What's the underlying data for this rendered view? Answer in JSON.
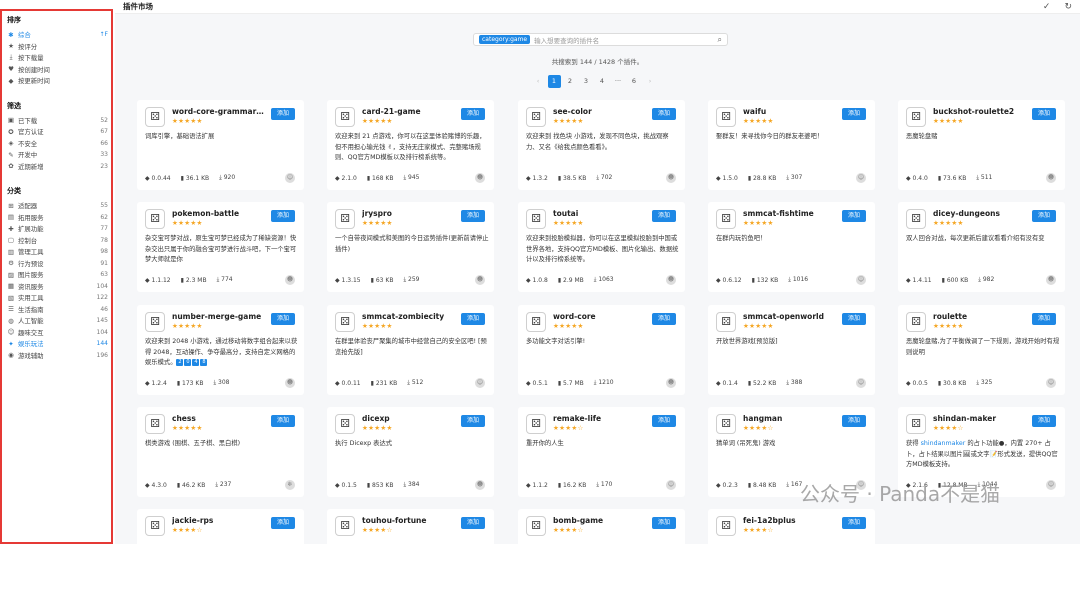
{
  "sidebar": {
    "sort_title": "排序",
    "sort_items": [
      {
        "label": "综合",
        "icon": "sparkle-icon",
        "glyph": "✱",
        "count": "↑F",
        "active": true
      },
      {
        "label": "按评分",
        "icon": "star-icon",
        "glyph": "★",
        "count": "",
        "active": false
      },
      {
        "label": "按下载量",
        "icon": "download-icon",
        "glyph": "⤓",
        "count": "",
        "active": false
      },
      {
        "label": "按创建时间",
        "icon": "heart-icon",
        "glyph": "♥",
        "count": "",
        "active": false
      },
      {
        "label": "按更新时间",
        "icon": "tag-icon",
        "glyph": "◆",
        "count": "",
        "active": false
      }
    ],
    "filter_title": "筛选",
    "filter_items": [
      {
        "label": "已下载",
        "icon": "lock-icon",
        "glyph": "▣",
        "count": "52"
      },
      {
        "label": "官方认证",
        "icon": "badge-icon",
        "glyph": "✪",
        "count": "67"
      },
      {
        "label": "不安全",
        "icon": "shield-icon",
        "glyph": "◈",
        "count": "66"
      },
      {
        "label": "开发中",
        "icon": "wrench-icon",
        "glyph": "✎",
        "count": "33"
      },
      {
        "label": "近期新增",
        "icon": "sprout-icon",
        "glyph": "✿",
        "count": "23"
      }
    ],
    "category_title": "分类",
    "category_items": [
      {
        "label": "适配器",
        "icon": "adapter-icon",
        "glyph": "⊞",
        "count": "55",
        "active": false
      },
      {
        "label": "拓用服务",
        "icon": "service-icon",
        "glyph": "▤",
        "count": "62",
        "active": false
      },
      {
        "label": "扩展功能",
        "icon": "puzzle-icon",
        "glyph": "✚",
        "count": "77",
        "active": false
      },
      {
        "label": "控制台",
        "icon": "console-icon",
        "glyph": "▢",
        "count": "78",
        "active": false
      },
      {
        "label": "管理工具",
        "icon": "tools-icon",
        "glyph": "▥",
        "count": "98",
        "active": false
      },
      {
        "label": "行为预设",
        "icon": "behavior-icon",
        "glyph": "⚙",
        "count": "91",
        "active": false
      },
      {
        "label": "图片服务",
        "icon": "image-icon",
        "glyph": "▨",
        "count": "63",
        "active": false
      },
      {
        "label": "资讯服务",
        "icon": "news-icon",
        "glyph": "▦",
        "count": "104",
        "active": false
      },
      {
        "label": "实用工具",
        "icon": "utility-icon",
        "glyph": "▧",
        "count": "122",
        "active": false
      },
      {
        "label": "生活指南",
        "icon": "life-icon",
        "glyph": "☰",
        "count": "46",
        "active": false
      },
      {
        "label": "人工智能",
        "icon": "ai-icon",
        "glyph": "◍",
        "count": "145",
        "active": false
      },
      {
        "label": "趣味交互",
        "icon": "fun-icon",
        "glyph": "☺",
        "count": "104",
        "active": false
      },
      {
        "label": "娱乐玩法",
        "icon": "entertainment-icon",
        "glyph": "✦",
        "count": "144",
        "active": true
      },
      {
        "label": "游戏辅助",
        "icon": "gamepad-icon",
        "glyph": "◉",
        "count": "196",
        "active": false
      }
    ]
  },
  "header": {
    "title": "插件市场",
    "check_glyph": "✓",
    "refresh_glyph": "↻"
  },
  "search": {
    "tag": "category:game",
    "placeholder": "输入想要查询的插件名",
    "icon_glyph": "⌕"
  },
  "results_text": "共搜索到 144 / 1428 个插件。",
  "pagination": {
    "prev": "‹",
    "pages": [
      "1",
      "2",
      "3",
      "4",
      "···",
      "6"
    ],
    "next": "›",
    "current": "1"
  },
  "add_label": "添加",
  "watermark": "公众号 · Panda不是猫",
  "cards": [
    {
      "name": "word-core-grammar-...",
      "stars": "★★★★★",
      "desc": "词库引擎，基础语法扩展",
      "version": "0.0.44",
      "size": "36.1 KB",
      "downloads": "920",
      "avatar": "☺"
    },
    {
      "name": "card-21-game",
      "stars": "★★★★★",
      "desc": "欢迎来到 21 点游戏，你可以在这里体验赌博的乐趣，但不用担心输光钱 ✌，支持无庄家模式、完整赌场规则、QQ官方MD模板以及排行榜系统等。",
      "version": "2.1.0",
      "size": "168 KB",
      "downloads": "945",
      "avatar": "☻"
    },
    {
      "name": "see-color",
      "stars": "★★★★★",
      "desc": "欢迎来到 找色块 小游戏，发现不同色块，挑战观察力、又名《给我点颜色看看》。",
      "version": "1.3.2",
      "size": "38.5 KB",
      "downloads": "702",
      "avatar": "☻"
    },
    {
      "name": "waifu",
      "stars": "★★★★★",
      "desc": "娶群友！来寻找你今日的群友老婆吧！",
      "version": "1.5.0",
      "size": "28.8 KB",
      "downloads": "307",
      "avatar": "☺"
    },
    {
      "name": "buckshot-roulette2",
      "stars": "★★★★★",
      "desc": "恶魔轮盘赌",
      "version": "0.4.0",
      "size": "73.6 KB",
      "downloads": "511",
      "avatar": "☻"
    },
    {
      "name": "pokemon-battle",
      "stars": "★★★★★",
      "desc": "杂交宝可梦对战，原生宝可梦已经成为了稀缺资源！快杂交出只属于你的融合宝可梦进行战斗吧，下一个宝可梦大师就是你",
      "version": "1.1.12",
      "size": "2.3 MB",
      "downloads": "774",
      "avatar": "☻"
    },
    {
      "name": "jryspro",
      "stars": "★★★★★",
      "desc": "一个自带夜间模式和美图的今日运势插件(更新前请停止插件)",
      "version": "1.3.15",
      "size": "63 KB",
      "downloads": "259",
      "avatar": "☻"
    },
    {
      "name": "toutai",
      "stars": "★★★★★",
      "desc": "欢迎来到投胎模拟器，你可以在这里模拟投胎到中国或世界各地，支持QQ官方MD模板、图片化输出、数据统计以及排行榜系统等。",
      "version": "1.0.8",
      "size": "2.9 MB",
      "downloads": "1063",
      "avatar": "☻"
    },
    {
      "name": "smmcat-fishtime",
      "stars": "★★★★★",
      "desc": "在群内玩钓鱼吧！",
      "version": "0.6.12",
      "size": "132 KB",
      "downloads": "1016",
      "avatar": "☺"
    },
    {
      "name": "dicey-dungeons",
      "stars": "★★★★★",
      "desc": "双人回合对战，每次更新后建议看看介绍有没有变",
      "version": "1.4.11",
      "size": "600 KB",
      "downloads": "982",
      "avatar": "☻"
    },
    {
      "name": "number-merge-game",
      "stars": "★★★★★",
      "desc": "欢迎来到 2048 小游戏，通过移动将数字组合起来以获得 2048，互动操作、争夺最高分，支持自定义网格的娱乐模式。",
      "version": "1.2.4",
      "size": "173 KB",
      "downloads": "308",
      "avatar": "☻",
      "tags": [
        "2",
        "0",
        "4",
        "8"
      ]
    },
    {
      "name": "smmcat-zombiecity",
      "stars": "★★★★★",
      "desc": "在群里体验丧尸聚集的城市中经营自己的安全区吧! [预览抢先版]",
      "version": "0.0.11",
      "size": "231 KB",
      "downloads": "512",
      "avatar": "☺"
    },
    {
      "name": "word-core",
      "stars": "★★★★★",
      "desc": "多功能文字对话引擎!",
      "version": "0.5.1",
      "size": "5.7 MB",
      "downloads": "1210",
      "avatar": "☻"
    },
    {
      "name": "smmcat-openworld",
      "stars": "★★★★★",
      "desc": "开放世界游戏[预览版]",
      "version": "0.1.4",
      "size": "52.2 KB",
      "downloads": "388",
      "avatar": "☺"
    },
    {
      "name": "roulette",
      "stars": "★★★★★",
      "desc": "恶魔轮盘赌,为了平衡做调了一下规则，游戏开始时有规则说明",
      "version": "0.0.5",
      "size": "30.8 KB",
      "downloads": "325",
      "avatar": "☺"
    },
    {
      "name": "chess",
      "stars": "★★★★★",
      "desc": "棋类游戏 (围棋、五子棋、黑白棋)",
      "version": "4.3.0",
      "size": "46.2 KB",
      "downloads": "237",
      "avatar": "❄"
    },
    {
      "name": "dicexp",
      "stars": "★★★★★",
      "desc": "执行 Dicexp 表达式",
      "version": "0.1.5",
      "size": "853 KB",
      "downloads": "384",
      "avatar": "☻"
    },
    {
      "name": "remake-life",
      "stars": "★★★★☆",
      "desc": "重开你的人生",
      "version": "1.1.2",
      "size": "16.2 KB",
      "downloads": "170",
      "avatar": "☺"
    },
    {
      "name": "hangman",
      "stars": "★★★★☆",
      "desc": "猜单词 (吊死鬼) 游戏",
      "version": "0.2.3",
      "size": "8.48 KB",
      "downloads": "167",
      "avatar": "☺"
    },
    {
      "name": "shindan-maker",
      "stars": "★★★★☆",
      "desc_pre": "获得 ",
      "desc_link": "shindanmaker",
      "desc_post": " 的占卜功能●，内置 270+ 占卜，占卜结果以图片🖼或文字📝形式发送，提供QQ官方MD模板支持。",
      "version": "2.1.6",
      "size": "12.8 MB",
      "downloads": "1044",
      "avatar": "☺"
    },
    {
      "name": "jackie-rps",
      "stars": "★★★★☆",
      "desc": "",
      "version": "",
      "size": "",
      "downloads": "",
      "avatar": ""
    },
    {
      "name": "touhou-fortune",
      "stars": "★★★★☆",
      "desc": "",
      "version": "",
      "size": "",
      "downloads": "",
      "avatar": ""
    },
    {
      "name": "bomb-game",
      "stars": "★★★★☆",
      "desc": "",
      "version": "",
      "size": "",
      "downloads": "",
      "avatar": ""
    },
    {
      "name": "fei-1a2bplus",
      "stars": "★★★★☆",
      "desc": "",
      "version": "",
      "size": "",
      "downloads": "",
      "avatar": ""
    }
  ]
}
